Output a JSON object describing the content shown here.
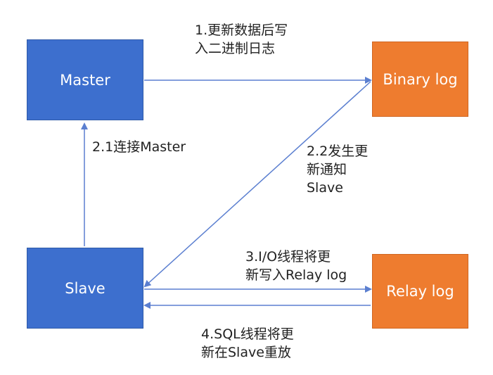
{
  "nodes": {
    "master": "Master",
    "slave": "Slave",
    "binary_log": "Binary log",
    "relay_log": "Relay log"
  },
  "labels": {
    "step1": [
      "1.更新数据后写",
      "入二进制日志"
    ],
    "step2_1": [
      "2.1连接Master"
    ],
    "step2_2": [
      "2.2发生更",
      "新通知",
      "Slave"
    ],
    "step3": [
      "3.I/O线程将更",
      "新写入Relay log"
    ],
    "step4": [
      "4.SQL线程将更",
      "新在Slave重放"
    ]
  },
  "colors": {
    "master": "#3d6fce",
    "slave": "#3d6fce",
    "binary_log": "#ee7c2f",
    "relay_log": "#ee7c2f",
    "arrow": "#5b7fd0"
  }
}
